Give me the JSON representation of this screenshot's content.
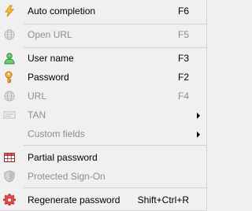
{
  "menu": {
    "items": [
      {
        "label": "Auto completion",
        "shortcut": "F6",
        "icon": "lightning-icon",
        "enabled": true
      },
      {
        "label": "Open URL",
        "shortcut": "F5",
        "icon": "globe-icon",
        "enabled": false
      },
      {
        "label": "User name",
        "shortcut": "F3",
        "icon": "user-icon",
        "enabled": true
      },
      {
        "label": "Password",
        "shortcut": "F2",
        "icon": "key-icon",
        "enabled": true
      },
      {
        "label": "URL",
        "shortcut": "F4",
        "icon": "globe-icon",
        "enabled": false
      },
      {
        "label": "TAN",
        "shortcut": "",
        "icon": "tan-icon",
        "enabled": false,
        "submenu": true
      },
      {
        "label": "Custom fields",
        "shortcut": "",
        "icon": "",
        "enabled": false,
        "submenu": true
      },
      {
        "label": "Partial password",
        "shortcut": "",
        "icon": "grid-icon",
        "enabled": true
      },
      {
        "label": "Protected Sign-On",
        "shortcut": "",
        "icon": "shield-icon",
        "enabled": false
      },
      {
        "label": "Regenerate password",
        "shortcut": "Shift+Ctrl+R",
        "icon": "gear-icon",
        "enabled": true
      }
    ]
  },
  "colors": {
    "lightning": "#e6a117",
    "user": "#2f9a3a",
    "key": "#c98a1e",
    "grid": "#c0392b",
    "gear": "#d23b3b",
    "disabled": "#8d8d8d"
  }
}
